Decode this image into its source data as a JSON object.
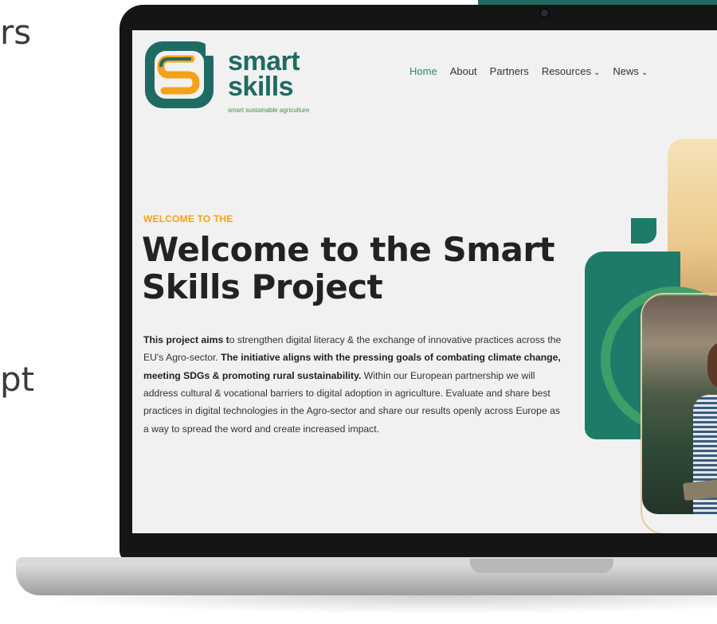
{
  "slide_fragments": {
    "line1": "rs",
    "line2": "pt"
  },
  "site": {
    "brand": {
      "word1": "smart",
      "word2": "skills",
      "tagline": "smart sustainable agriculture"
    },
    "nav": {
      "items": [
        {
          "label": "Home",
          "active": true,
          "dropdown": false
        },
        {
          "label": "About",
          "active": false,
          "dropdown": false
        },
        {
          "label": "Partners",
          "active": false,
          "dropdown": false
        },
        {
          "label": "Resources",
          "active": false,
          "dropdown": true
        },
        {
          "label": "News",
          "active": false,
          "dropdown": true
        }
      ],
      "chevron": "chevron-down-icon"
    },
    "hero": {
      "eyebrow": "WELCOME TO THE",
      "title": "Welcome to the Smart Skills Project",
      "body": {
        "p1_bold": "This project aims t",
        "p1": "o strengthen digital literacy & the exchange of innovative practices across the EU's Agro-sector. ",
        "p2_bold": "The initiative aligns with the pressing goals of combating climate change, meeting SDGs & promoting rural sustainability.",
        "p3": " Within our European partnership we will address cultural & vocational barriers to digital adoption in agriculture. Evaluate and share best practices in digital technologies in the Agro-sector and share our results openly across Europe as a way to spread the word and create increased impact."
      }
    },
    "colors": {
      "brand_green": "#1f6b63",
      "accent_yellow": "#f3a21a",
      "nav_active": "#2f8a5a",
      "light_green": "#3f9d6a"
    }
  }
}
